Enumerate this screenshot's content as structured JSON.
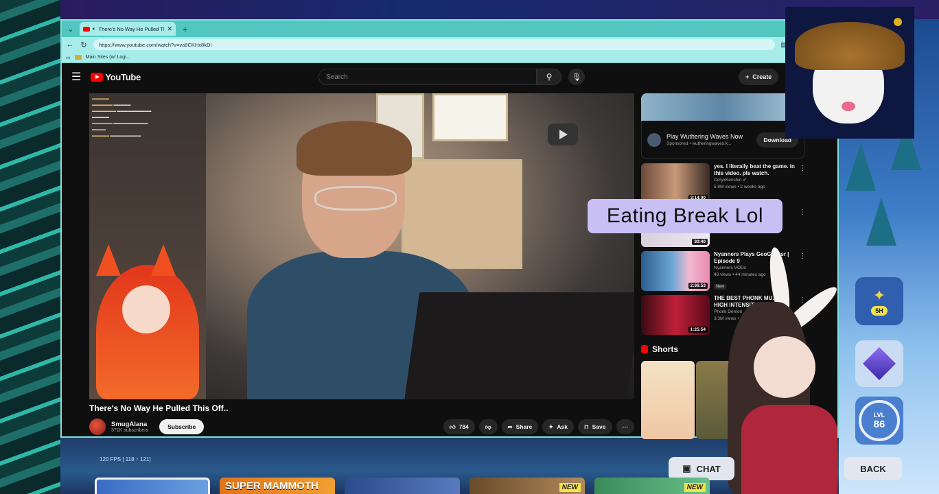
{
  "browser": {
    "tab_title": "There's No Way He Pulled Th",
    "url": "https://www.youtube.com/watch?v=va9CKHx8kDI",
    "bookmark": "Main Sites (w/ Logi..."
  },
  "youtube": {
    "logo": "YouTube",
    "search_placeholder": "Search",
    "create_label": "Create",
    "video": {
      "title": "There's No Way He Pulled This Off..",
      "channel": "SmugAlana",
      "subscribers": "371K subscribers",
      "subscribe_label": "Subscribe",
      "likes": "784",
      "share_label": "Share",
      "ask_label": "Ask",
      "save_label": "Save"
    },
    "ad": {
      "title": "Play Wuthering Waves Now",
      "sponsor": "Sponsored • wutheringwaves.k...",
      "download_label": "Download"
    },
    "recommendations": [
      {
        "title": "yes. I literally beat the game. in this video. pls watch.",
        "channel": "CoryxKenshin ✔",
        "meta": "5.9M views • 2 weeks ago",
        "duration": "3:14:00",
        "badge": ""
      },
      {
        "title": "",
        "channel": "",
        "meta": "",
        "duration": "30:40",
        "badge": ""
      },
      {
        "title": "Nyanners Plays GeoGuessr | Episode 9",
        "channel": "Nyanners VODs",
        "meta": "48 views • 44 minutes ago",
        "duration": "2:36:53",
        "badge": "New"
      },
      {
        "title": "THE BEST PHONK MU... ※ HIGH INTENSITY",
        "channel": "Phonk Demon",
        "meta": "3.3M views • 1 year",
        "duration": "1:25:54",
        "badge": ""
      }
    ],
    "shorts_label": "Shorts"
  },
  "overlay": {
    "eating_text": "Eating  Break Lol",
    "timer": "5H",
    "level_label": "LVL",
    "level": "86",
    "fps": "120 FPS [ 118 ↑ 121]",
    "chat_btn": "CHAT",
    "back_btn": "BACK",
    "cards": [
      {
        "label": "",
        "new": ""
      },
      {
        "label": "SUPER MAMMOTH",
        "new": ""
      },
      {
        "label": "",
        "new": ""
      },
      {
        "label": "",
        "new": "NEW"
      },
      {
        "label": "",
        "new": "NEW"
      }
    ]
  },
  "colors": {
    "yt_red": "#ff0000",
    "browser_accent": "#53c6c0",
    "eating_bg": "#c8c0f4"
  }
}
